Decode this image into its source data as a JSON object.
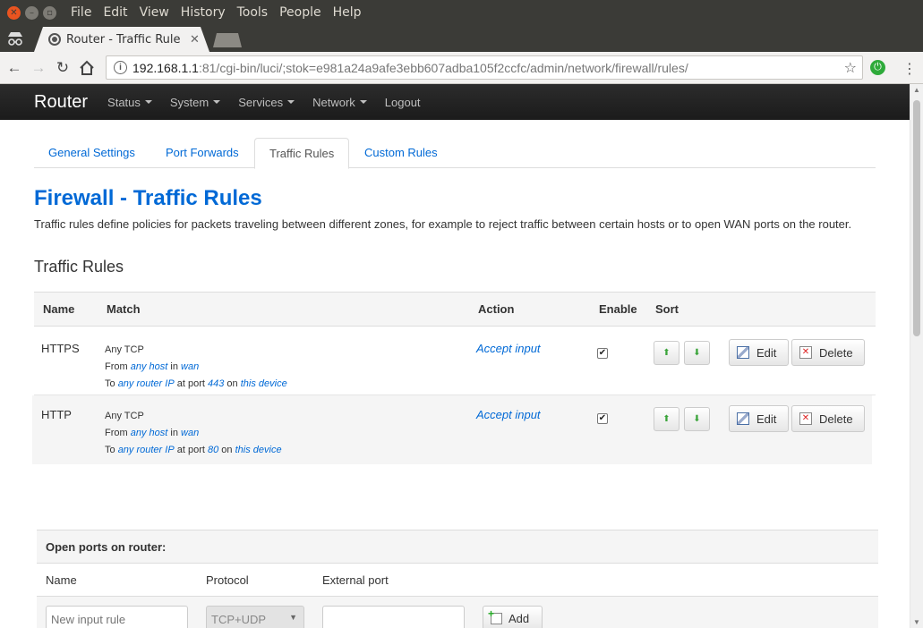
{
  "window": {
    "menu": [
      "File",
      "Edit",
      "View",
      "History",
      "Tools",
      "People",
      "Help"
    ],
    "tab_title": "Router - Traffic Rule",
    "url_host": "192.168.1.1",
    "url_path": ":81/cgi-bin/luci/;stok=e981a24a9afe3ebb607adba105f2ccfc/admin/network/firewall/rules/"
  },
  "navbar": {
    "brand": "Router",
    "items": [
      "Status",
      "System",
      "Services",
      "Network",
      "Logout"
    ]
  },
  "tabs": [
    "General Settings",
    "Port Forwards",
    "Traffic Rules",
    "Custom Rules"
  ],
  "active_tab": "Traffic Rules",
  "page": {
    "title": "Firewall - Traffic Rules",
    "description": "Traffic rules define policies for packets traveling between different zones, for example to reject traffic between certain hosts or to open WAN ports on the router.",
    "section_title": "Traffic Rules"
  },
  "table": {
    "columns": {
      "name": "Name",
      "match": "Match",
      "action": "Action",
      "enable": "Enable",
      "sort": "Sort"
    },
    "rows": [
      {
        "name": "HTTPS",
        "proto": "Any TCP",
        "from_prefix": "From",
        "from_host": "any host",
        "from_in": "in",
        "from_zone": "wan",
        "to_prefix": "To",
        "to_ip": "any router IP",
        "to_port_prefix": "at port",
        "port": "443",
        "to_on": "on",
        "to_device": "this device",
        "action": "Accept input",
        "enabled": true,
        "edit_label": "Edit",
        "delete_label": "Delete"
      },
      {
        "name": "HTTP",
        "proto": "Any TCP",
        "from_prefix": "From",
        "from_host": "any host",
        "from_in": "in",
        "from_zone": "wan",
        "to_prefix": "To",
        "to_ip": "any router IP",
        "to_port_prefix": "at port",
        "port": "80",
        "to_on": "on",
        "to_device": "this device",
        "action": "Accept input",
        "enabled": true,
        "edit_label": "Edit",
        "delete_label": "Delete"
      }
    ]
  },
  "open_ports": {
    "title": "Open ports on router:",
    "col_name": "Name",
    "col_protocol": "Protocol",
    "col_external_port": "External port",
    "name_placeholder": "New input rule",
    "protocol_value": "TCP+UDP",
    "add_label": "Add"
  }
}
